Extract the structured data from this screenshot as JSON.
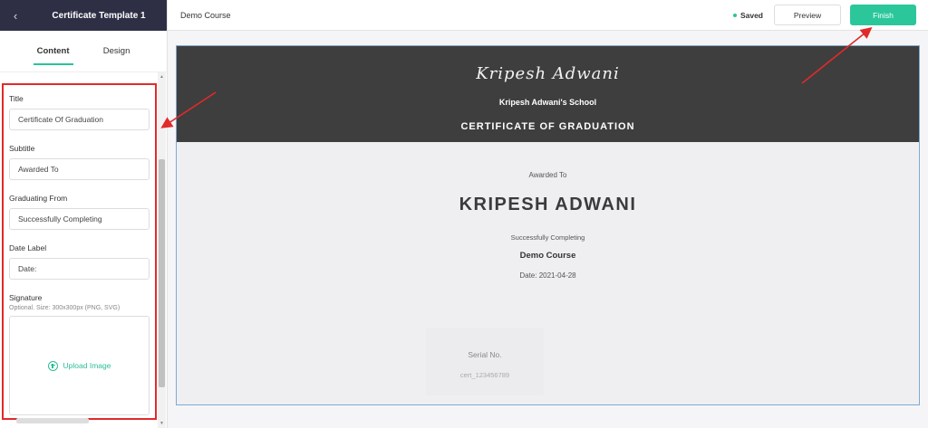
{
  "sidebar": {
    "title": "Certificate Template 1",
    "back_icon": "chevron-left-icon",
    "tabs": [
      {
        "label": "Content",
        "active": true
      },
      {
        "label": "Design",
        "active": false
      }
    ],
    "fields": {
      "title_label": "Title",
      "title_value": "Certificate Of Graduation",
      "subtitle_label": "Subtitle",
      "subtitle_value": "Awarded To",
      "graduating_label": "Graduating From",
      "graduating_value": "Successfully Completing",
      "date_label": "Date Label",
      "date_value": "Date:",
      "signature_label": "Signature",
      "signature_hint": "Optional. Size: 300x300px (PNG, SVG)",
      "upload_label": "Upload Image"
    }
  },
  "topbar": {
    "course_name": "Demo Course",
    "saved_label": "Saved",
    "preview_label": "Preview",
    "finish_label": "Finish"
  },
  "certificate": {
    "logo_text": "Kripesh Adwani",
    "school": "Kripesh Adwani's School",
    "title": "CERTIFICATE OF GRADUATION",
    "awarded": "Awarded To",
    "recipient": "KRIPESH ADWANI",
    "completing": "Successfully Completing",
    "course": "Demo Course",
    "date": "Date: 2021-04-28",
    "serial_label": "Serial No.",
    "serial_value": "cert_123456789"
  },
  "colors": {
    "sidebar_header": "#2e2f45",
    "accent": "#2bc79b",
    "cert_header": "#3e3e3e",
    "annotation": "#e12a2a"
  }
}
